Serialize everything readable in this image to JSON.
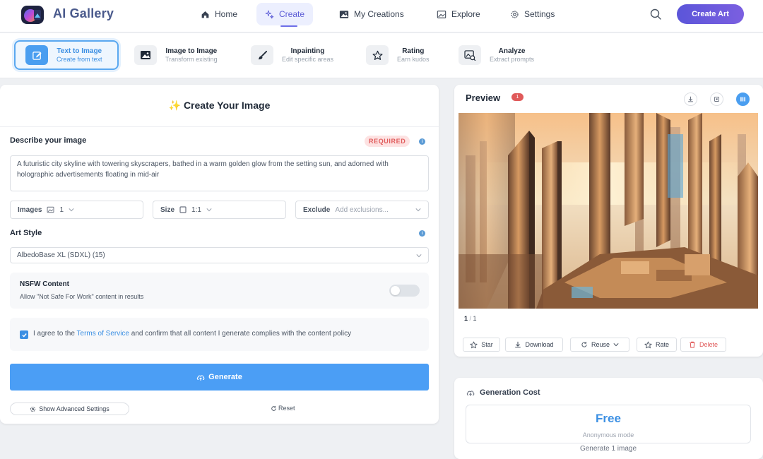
{
  "app": {
    "brand": "AI Gallery"
  },
  "nav": {
    "items": [
      {
        "label": "Home",
        "icon": "home-icon"
      },
      {
        "label": "Create",
        "icon": "sparkle-icon",
        "active": true
      },
      {
        "label": "My Creations",
        "icon": "image-icon"
      },
      {
        "label": "Explore",
        "icon": "picture-icon"
      },
      {
        "label": "Settings",
        "icon": "gear-icon"
      }
    ],
    "create_art": "Create Art"
  },
  "modes": [
    {
      "title": "Text to Image",
      "subtitle": "Create from text",
      "icon": "edit-icon",
      "active": true
    },
    {
      "title": "Image to Image",
      "subtitle": "Transform existing",
      "icon": "image-icon"
    },
    {
      "title": "Inpainting",
      "subtitle": "Edit specific areas",
      "icon": "brush-icon"
    },
    {
      "title": "Rating",
      "subtitle": "Earn kudos",
      "icon": "star-icon"
    },
    {
      "title": "Analyze",
      "subtitle": "Extract prompts",
      "icon": "analyze-image-icon"
    }
  ],
  "form": {
    "title": "✨ Create Your Image",
    "describe_label": "Describe your image",
    "required_badge": "REQUIRED",
    "prompt_value": "A futuristic city skyline with towering skyscrapers, bathed in a warm golden glow from the setting sun, and adorned with holographic advertisements floating in mid-air",
    "images_label": "Images",
    "images_value": "1",
    "size_label": "Size",
    "size_value": "1:1",
    "exclude_label": "Exclude",
    "exclude_placeholder": "Add exclusions...",
    "art_style_label": "Art Style",
    "art_style_value": "AlbedoBase XL (SDXL) (15)",
    "nsfw_title": "NSFW Content",
    "nsfw_desc": "Allow \"Not Safe For Work\" content in results",
    "nsfw_enabled": false,
    "agree_checked": true,
    "agree_prefix": "I agree to the ",
    "agree_link": "Terms of Service",
    "agree_suffix": " and confirm that all content I generate complies with the content policy",
    "generate": "Generate",
    "advanced": "Show Advanced Settings",
    "reset": "Reset"
  },
  "preview": {
    "title": "Preview",
    "badge": "1",
    "page_current": "1",
    "page_sep": " / ",
    "page_total": "1",
    "actions": {
      "star": "Star",
      "download": "Download",
      "reuse": "Reuse",
      "rate": "Rate",
      "delete": "Delete"
    }
  },
  "cost": {
    "title": "Generation Cost",
    "price": "Free",
    "mode": "Anonymous mode",
    "note": "Generate 1 image"
  },
  "colors": {
    "accent": "#4b9ef5",
    "brand_gradient_start": "#5b55d9",
    "brand_gradient_end": "#7b5fe0",
    "danger": "#e05a5a"
  }
}
